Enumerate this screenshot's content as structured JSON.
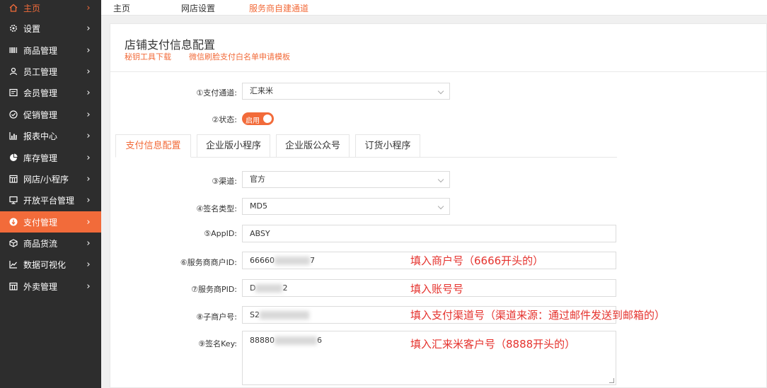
{
  "sidebar": {
    "items": [
      {
        "label": "主页",
        "icon": "home-icon"
      },
      {
        "label": "设置",
        "icon": "gear-icon"
      },
      {
        "label": "商品管理",
        "icon": "barcode-icon"
      },
      {
        "label": "员工管理",
        "icon": "user-icon"
      },
      {
        "label": "会员管理",
        "icon": "member-card-icon"
      },
      {
        "label": "促销管理",
        "icon": "check-circle-icon"
      },
      {
        "label": "报表中心",
        "icon": "bar-chart-icon"
      },
      {
        "label": "库存管理",
        "icon": "pie-chart-icon"
      },
      {
        "label": "网店/小程序",
        "icon": "store-icon"
      },
      {
        "label": "开放平台管理",
        "icon": "monitor-icon"
      },
      {
        "label": "支付管理",
        "icon": "payment-icon"
      },
      {
        "label": "商品货流",
        "icon": "cube-icon"
      },
      {
        "label": "数据可视化",
        "icon": "line-chart-icon"
      },
      {
        "label": "外卖管理",
        "icon": "shop-icon"
      }
    ],
    "chevron": "›"
  },
  "topnav": {
    "home": "主页",
    "shop_settings": "网店设置",
    "service_channel": "服务商自建通道"
  },
  "panel": {
    "title": "店铺支付信息配置",
    "link_key_tool": "秘钥工具下载",
    "link_wechat_face": "微信刷脸支付白名单申请模板"
  },
  "form": {
    "pay_channel": {
      "label": "①支付通道:",
      "value": "汇来米"
    },
    "status": {
      "label": "②状态:",
      "toggle_text": "启用"
    },
    "tabs": [
      "支付信息配置",
      "企业版小程序",
      "企业版公众号",
      "订货小程序"
    ],
    "channel": {
      "label": "③渠道:",
      "value": "官方"
    },
    "sign_type": {
      "label": "④签名类型:",
      "value": "MD5"
    },
    "app_id": {
      "label": "⑤AppID:",
      "value": "ABSY"
    },
    "merchant_id": {
      "label": "⑥服务商商户ID:",
      "value_prefix": "66660",
      "value_suffix": "7",
      "note": "填入商户号（6666开头的）"
    },
    "pid": {
      "label": "⑦服务商PID:",
      "value_prefix": "D",
      "value_suffix": "2",
      "note": "填入账号号"
    },
    "sub_merchant": {
      "label": "⑧子商户号:",
      "value_prefix": "S2",
      "value_suffix": "",
      "note": "填入支付渠道号（渠道来源：通过邮件发送到邮箱的）"
    },
    "sign_key": {
      "label": "⑨签名Key:",
      "value_prefix": "88880",
      "value_suffix": "6",
      "note": "填入汇来米客户号（8888开头的）"
    }
  },
  "colors": {
    "accent": "#f26b3a",
    "sidebar_bg": "#2d2d2d",
    "note_red": "#e5322d"
  }
}
